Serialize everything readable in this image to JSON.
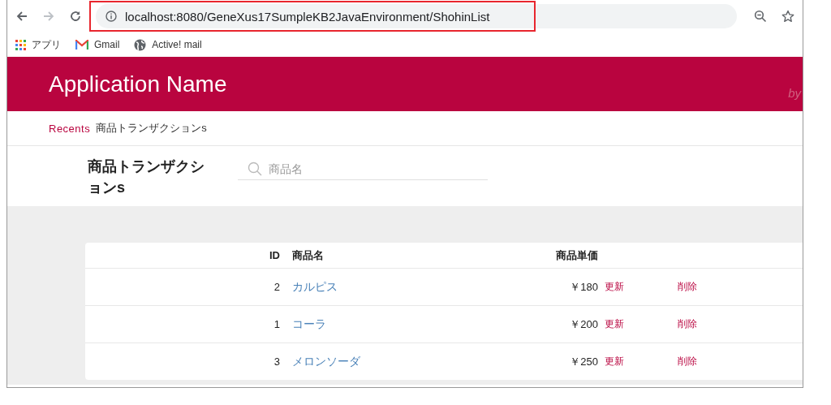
{
  "browser": {
    "url": "localhost:8080/GeneXus17SumpleKB2JavaEnvironment/ShohinList",
    "url_highlighted": true,
    "bookmarks": [
      {
        "label": "アプリ",
        "kind": "apps"
      },
      {
        "label": "Gmail",
        "kind": "mail"
      },
      {
        "label": "Active! mail",
        "kind": "globe"
      }
    ]
  },
  "header": {
    "app_name": "Application Name",
    "byline": "by"
  },
  "breadcrumb": {
    "link": "Recents",
    "current": "商品トランザクションs"
  },
  "page": {
    "title": "商品トランザクションs",
    "search": {
      "placeholder": "商品名"
    }
  },
  "table": {
    "columns": [
      "ID",
      "商品名",
      "商品単価"
    ],
    "rows": [
      {
        "id": "2",
        "name": "カルピス",
        "price": "￥180",
        "update": "更新",
        "delete": "削除"
      },
      {
        "id": "1",
        "name": "コーラ",
        "price": "￥200",
        "update": "更新",
        "delete": "削除"
      },
      {
        "id": "3",
        "name": "メロンソーダ",
        "price": "￥250",
        "update": "更新",
        "delete": "削除"
      }
    ]
  }
}
